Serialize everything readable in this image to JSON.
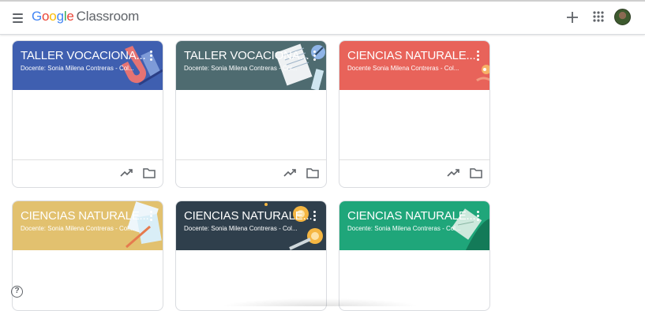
{
  "app": {
    "logo_google": [
      "G",
      "o",
      "o",
      "g",
      "l",
      "e"
    ],
    "logo_product": "Classroom",
    "icons": {
      "menu": "hamburger-menu-icon",
      "create": "plus-icon",
      "apps": "apps-grid-icon",
      "account": "avatar",
      "help": "help-circle-icon"
    },
    "help_label": "?"
  },
  "classes": [
    {
      "title": "TALLER VOCACIONA...",
      "teacher": "Docente: Sonia Milena Contreras - Col...",
      "color": "#3f5fb0",
      "theme": "magnet"
    },
    {
      "title": "TALLER VOCACIONA...",
      "teacher": "Docente: Sonia Milena Contreras - Col...",
      "color": "#4e6b70",
      "theme": "notebook"
    },
    {
      "title": "CIENCIAS NATURALE...",
      "teacher": "Docente Sonia Milena Contreras - Col...",
      "color": "#e8635a",
      "theme": "science"
    },
    {
      "title": "CIENCIAS NATURALE...",
      "teacher": "Docente: Sonia Milena Contreras - Col...",
      "color": "#e2c16f",
      "theme": "papers"
    },
    {
      "title": "CIENCIAS NATURALE...",
      "teacher": "Docente: Sonia Milena Contreras - Col...",
      "color": "#2f3f4c",
      "theme": "lights"
    },
    {
      "title": "CIENCIAS NATURALE...",
      "teacher": "Docente: Sonia Milena Contreras - Col...",
      "color": "#1fa67a",
      "theme": "tablet"
    }
  ],
  "card_actions": {
    "progress_icon": "trending-up-icon",
    "folder_icon": "folder-icon"
  }
}
